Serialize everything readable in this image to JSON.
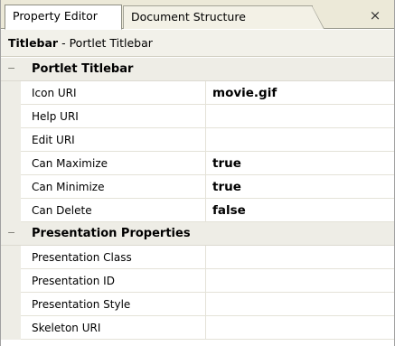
{
  "tabs": [
    {
      "label": "Property Editor"
    },
    {
      "label": "Document Structure"
    }
  ],
  "close_glyph": "×",
  "object": {
    "type": "Titlebar",
    "separator": " - ",
    "description": "Portlet Titlebar"
  },
  "categories": [
    {
      "label": "Portlet Titlebar",
      "toggle": "−",
      "properties": [
        {
          "name": "Icon URI",
          "value": "movie.gif"
        },
        {
          "name": "Help URI",
          "value": ""
        },
        {
          "name": "Edit URI",
          "value": ""
        },
        {
          "name": "Can Maximize",
          "value": "true"
        },
        {
          "name": "Can Minimize",
          "value": "true"
        },
        {
          "name": "Can Delete",
          "value": "false"
        }
      ]
    },
    {
      "label": "Presentation Properties",
      "toggle": "−",
      "properties": [
        {
          "name": "Presentation Class",
          "value": ""
        },
        {
          "name": "Presentation ID",
          "value": ""
        },
        {
          "name": "Presentation Style",
          "value": ""
        },
        {
          "name": "Skeleton URI",
          "value": ""
        }
      ]
    }
  ]
}
